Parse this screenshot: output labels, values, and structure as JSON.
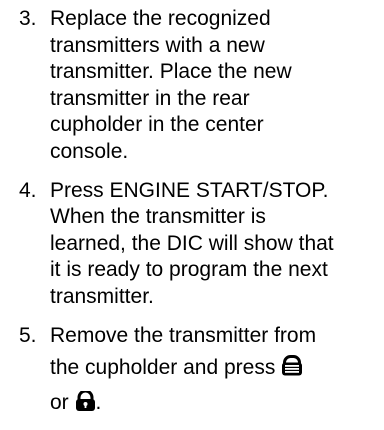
{
  "steps": [
    {
      "number": "3.",
      "lines": [
        "Replace the recognized",
        "transmitters with a new",
        "transmitter. Place the new",
        "transmitter in the rear",
        "cupholder in the center",
        "console."
      ]
    },
    {
      "number": "4.",
      "lines": [
        "Press ENGINE START/STOP.",
        "When the transmitter is",
        "learned, the DIC will show that",
        "it is ready to program the next",
        "transmitter."
      ]
    },
    {
      "number": "5.",
      "lines": [
        "Remove the transmitter from",
        "the cupholder and press",
        "or",
        "."
      ],
      "icons": [
        "lock-closed-icon",
        "unlock-icon"
      ]
    }
  ]
}
